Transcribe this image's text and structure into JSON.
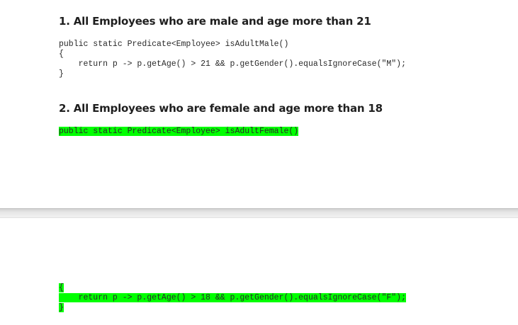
{
  "section1": {
    "heading": "1. All Employees who are male and age more than 21",
    "code_lines": [
      "public static Predicate<Employee> isAdultMale()",
      "{",
      "    return p -> p.getAge() > 21 && p.getGender().equalsIgnoreCase(\"M\");",
      "}"
    ]
  },
  "section2": {
    "heading": "2. All Employees who are female and age more than 18",
    "code_line_top": "public static Predicate<Employee> isAdultFemale()",
    "code_lines_bottom": [
      "{",
      "    return p -> p.getAge() > 18 && p.getGender().equalsIgnoreCase(\"F\");",
      "}"
    ],
    "highlight_color": "#00ff00"
  }
}
